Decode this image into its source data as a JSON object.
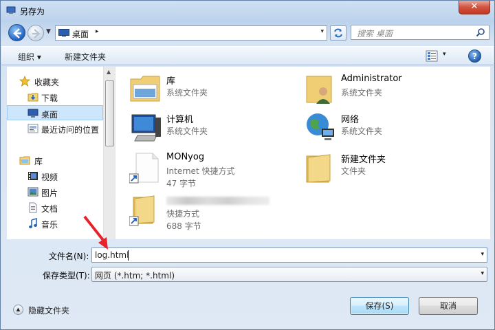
{
  "window": {
    "title": "另存为",
    "close_label": "✕"
  },
  "address": {
    "location": "桌面",
    "separator": "▸",
    "dropdown": "▾"
  },
  "search": {
    "placeholder": "搜索 桌面"
  },
  "toolbar": {
    "organize_label": "组织 ▾",
    "new_folder_label": "新建文件夹",
    "view_dropdown": "▾",
    "help_label": "?"
  },
  "sidebar": {
    "favorites_label": "收藏夹",
    "favorites": [
      {
        "label": "下载",
        "icon": "download-folder-icon"
      },
      {
        "label": "桌面",
        "icon": "desktop-icon",
        "selected": true
      },
      {
        "label": "最近访问的位置",
        "icon": "recent-places-icon"
      }
    ],
    "library_label": "库",
    "libraries": [
      {
        "label": "视频",
        "icon": "video-icon"
      },
      {
        "label": "图片",
        "icon": "picture-icon"
      },
      {
        "label": "文档",
        "icon": "document-icon"
      },
      {
        "label": "音乐",
        "icon": "music-icon"
      }
    ]
  },
  "files": [
    {
      "name": "库",
      "line1": "系统文件夹",
      "line2": "",
      "icon": "library-folder-icon"
    },
    {
      "name": "Administrator",
      "line1": "系统文件夹",
      "line2": "",
      "icon": "user-folder-icon"
    },
    {
      "name": "计算机",
      "line1": "系统文件夹",
      "line2": "",
      "icon": "computer-icon"
    },
    {
      "name": "网络",
      "line1": "系统文件夹",
      "line2": "",
      "icon": "network-globe-icon"
    },
    {
      "name": "MONyog",
      "line1": "Internet 快捷方式",
      "line2": "47 字节",
      "icon": "shortcut-file-icon"
    },
    {
      "name": "新建文件夹",
      "line1": "文件夹",
      "line2": "",
      "icon": "folder-icon"
    },
    {
      "name": "",
      "line1": "快捷方式",
      "line2": "688 字节",
      "icon": "folder-shortcut-icon"
    }
  ],
  "form": {
    "filename_label": "文件名(N):",
    "filename_value": "log.html",
    "filetype_label": "保存类型(T):",
    "filetype_value": "网页 (*.htm; *.html)",
    "dropdown": "▾"
  },
  "footer": {
    "hide_folders_label": "隐藏文件夹",
    "hide_folders_icon": "▲",
    "save_label": "保存(S)",
    "cancel_label": "取消"
  },
  "colors": {
    "annotation_arrow": "#e8222a",
    "selected_bg": "#cde6fb"
  }
}
